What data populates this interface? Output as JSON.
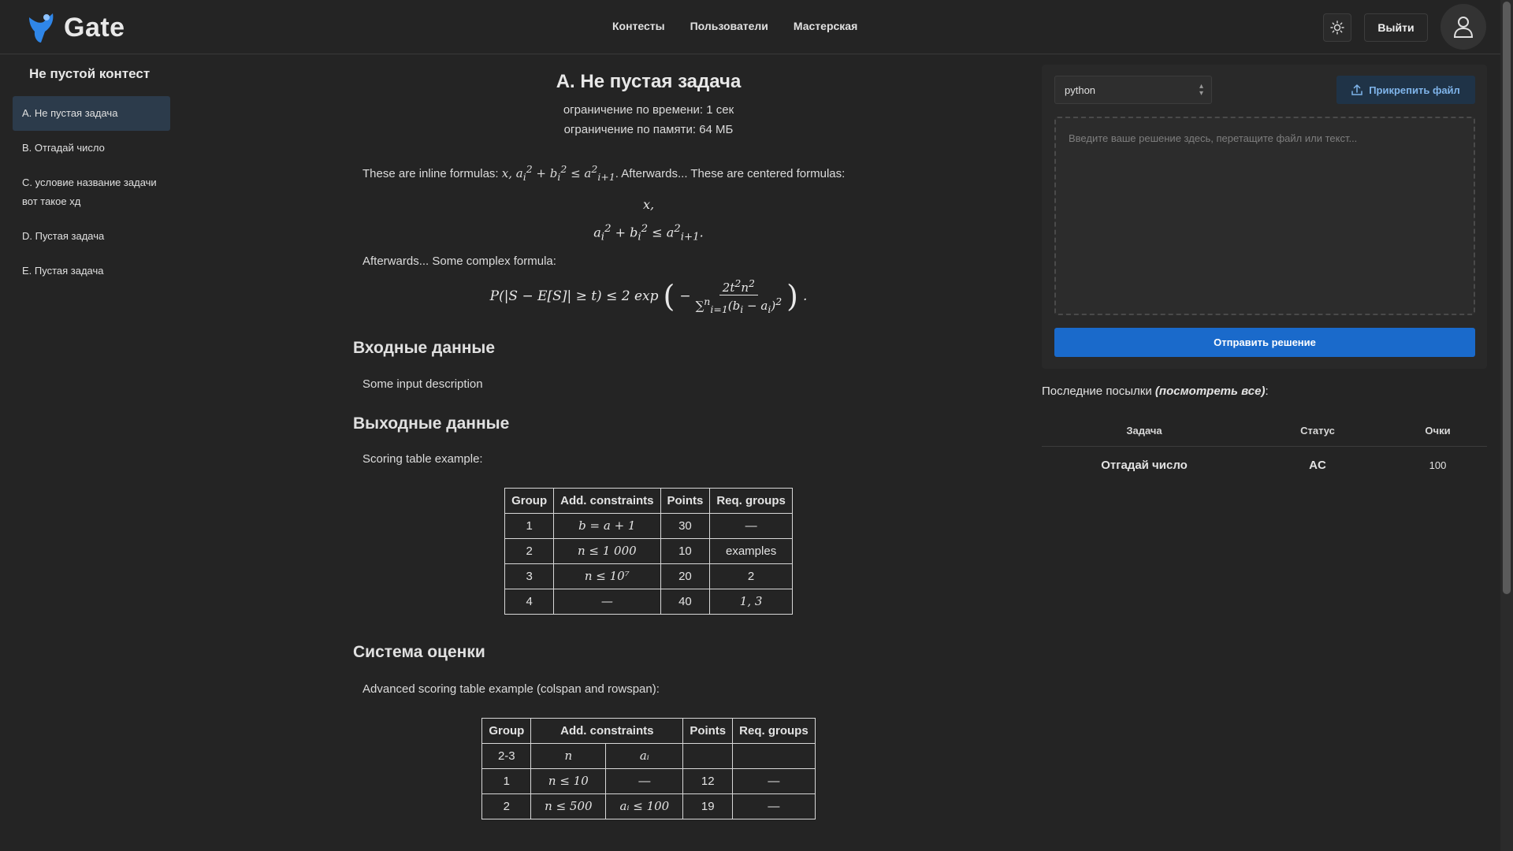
{
  "app": {
    "name": "Gate"
  },
  "nav": {
    "contests": "Контесты",
    "users": "Пользователи",
    "workshop": "Мастерская"
  },
  "header": {
    "logout": "Выйти"
  },
  "contest": {
    "title": "Не пустой контест",
    "problems": [
      {
        "label": "A. Не пустая задача"
      },
      {
        "label": "B. Отгадай число"
      },
      {
        "label": "C. условие название задачи вот такое хд"
      },
      {
        "label": "D. Пустая задача"
      },
      {
        "label": "E. Пустая задача"
      }
    ]
  },
  "problem": {
    "title": "A. Не пустая задача",
    "time_limit": "ограничение по времени: 1 сек",
    "memory_limit": "ограничение по памяти: 64 МБ",
    "intro_before": "These are inline formulas: ",
    "intro_after": ". Afterwards... These are centered formulas:",
    "complex_text": "Afterwards... Some complex formula:",
    "input_heading": "Входные данные",
    "input_text": "Some input description",
    "output_heading": "Выходные данные",
    "scoring_text": "Scoring table example:",
    "scoring_heading": "Система оценки",
    "advanced_text": "Advanced scoring table example (colspan and rowspan):",
    "table1": {
      "headers": [
        "Group",
        "Add. constraints",
        "Points",
        "Req. groups"
      ],
      "rows": [
        [
          "1",
          "b = a + 1",
          "30",
          "—"
        ],
        [
          "2",
          "n ≤ 1 000",
          "10",
          "examples"
        ],
        [
          "3",
          "n ≤ 10⁷",
          "20",
          "2"
        ],
        [
          "4",
          "—",
          "40",
          "1, 3"
        ]
      ]
    },
    "table2": {
      "headers": [
        "Group",
        "Add. constraints",
        "Points",
        "Req. groups"
      ],
      "subheaders": [
        "2-3",
        "n",
        "aᵢ",
        "",
        ""
      ],
      "rows": [
        [
          "1",
          "n ≤ 10",
          "—",
          "12",
          "—"
        ],
        [
          "2",
          "n ≤ 500",
          "aᵢ ≤ 100",
          "19",
          "—"
        ]
      ]
    }
  },
  "submit": {
    "language": "python",
    "attach": "Прикрепить файл",
    "placeholder": "Введите ваше решение здесь, перетащите файл или текст...",
    "send": "Отправить решение"
  },
  "recent": {
    "title": "Последние посылки ",
    "view_all": "(посмотреть все)",
    "colon": ":",
    "headers": [
      "Задача",
      "Статус",
      "Очки"
    ],
    "rows": [
      {
        "task": "Отгадай число",
        "status": "AC",
        "score": "100"
      }
    ]
  },
  "colors": {
    "accent": "#1a6acb",
    "status_ok": "#2ecc40",
    "background": "#242424"
  }
}
